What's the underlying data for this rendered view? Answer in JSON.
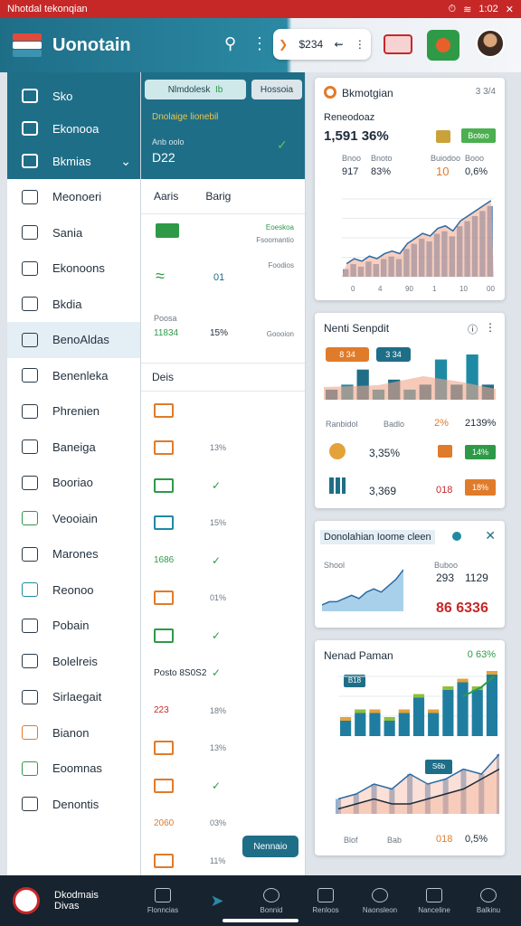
{
  "status": {
    "left": "Nhotdal tekonqian",
    "time": "1:02"
  },
  "app": {
    "title": "Uonotain",
    "pill_value": "$234"
  },
  "sidebar": {
    "top_items": [
      {
        "label": "Sko"
      },
      {
        "label": "Ekonooa"
      },
      {
        "label": "Bkmias"
      }
    ],
    "items": [
      {
        "label": "Meonoeri"
      },
      {
        "label": "Sania"
      },
      {
        "label": "Ekonoons"
      },
      {
        "label": "Bkdia"
      },
      {
        "label": "BenoAldas"
      },
      {
        "label": "Benenleka"
      },
      {
        "label": "Phrenien"
      },
      {
        "label": "Baneiga"
      },
      {
        "label": "Booriao"
      },
      {
        "label": "Veooiain"
      },
      {
        "label": "Marones"
      },
      {
        "label": "Reonoo"
      },
      {
        "label": "Pobain"
      },
      {
        "label": "Bolelreis"
      },
      {
        "label": "Sirlaegait"
      },
      {
        "label": "Bianon"
      },
      {
        "label": "Eoomnas"
      },
      {
        "label": "Denontis"
      }
    ]
  },
  "middle": {
    "tab1": "Nlmdolesk",
    "tab1b": "Ib",
    "tab2": "Hossoia",
    "small": "Dnolaige lionebil",
    "sub": "Anb oolo",
    "big": "D22",
    "col1": "Aaris",
    "col2": "Barig",
    "row1_label": "Eoeskoa",
    "row1_sub": "Fsoomantio",
    "row2_val": "01",
    "row2_label": "Foodios",
    "row3_title": "Poosa",
    "row3_val": "11834",
    "row3_pct": "15%",
    "row3_label": "Goooion",
    "details": "Deis",
    "details_rows": [
      {
        "kind": "icon",
        "color": "#e07b2a",
        "val": ""
      },
      {
        "kind": "icon",
        "color": "#e07b2a",
        "val": "13%"
      },
      {
        "kind": "icon",
        "color": "#2e9a48",
        "val": "✓"
      },
      {
        "kind": "icon",
        "color": "#1f8aa3",
        "val": "15%"
      },
      {
        "kind": "text",
        "text": "1686",
        "color": "#2e9a48",
        "val": "✓"
      },
      {
        "kind": "icon",
        "color": "#e07b2a",
        "val": "01%"
      },
      {
        "kind": "icon",
        "color": "#2e9a48",
        "val": "✓"
      },
      {
        "kind": "text",
        "text": "Posto 8S0S2",
        "color": "#1d2b3a",
        "val": "✓"
      },
      {
        "kind": "text",
        "text": "223",
        "color": "#c62828",
        "val": "18%"
      },
      {
        "kind": "icon",
        "color": "#e07b2a",
        "val": "13%"
      },
      {
        "kind": "icon",
        "color": "#e07b2a",
        "val": "✓"
      },
      {
        "kind": "text",
        "text": "2060",
        "color": "#e07b2a",
        "val": "03%"
      },
      {
        "kind": "icon",
        "color": "#e07b2a",
        "val": "11%"
      }
    ],
    "button": "Nennaio"
  },
  "card1": {
    "title": "Bkmotgian",
    "badge": "3 3/4",
    "subtitle": "Reneodoaz",
    "value": "1,591 36%",
    "green_tag": "Boteo",
    "stat1": "917",
    "stat2": "83%",
    "stat3": "10",
    "stat4": "0,6%",
    "stat_labels": [
      "Bnoo",
      "Bnoto",
      "Buiodoo",
      "Booo"
    ]
  },
  "card2": {
    "title": "Nenti Senpdit",
    "tag1": "8 34",
    "tag2": "3 34",
    "labels": [
      "Ranbidol",
      "Badlo",
      "2%",
      "2139%"
    ],
    "row1": "3,35%",
    "row2": "3,369",
    "row2_vals": [
      "018"
    ],
    "tag_green": "14%",
    "tag_orange": "18%"
  },
  "card3": {
    "title": "Donolahian Ioome cleen",
    "left_label": "Shool",
    "right_label": "Buboo",
    "v1": "293",
    "v2": "1129",
    "big": "86 6336"
  },
  "card4": {
    "title": "Nenad Paman",
    "badge": "0 63%",
    "tag": "B18",
    "tag2": "S6b",
    "foot": [
      "Blof",
      "Bab",
      "018",
      "0,5%"
    ]
  },
  "chart_data": [
    {
      "type": "bar",
      "title": "Bkmotgian",
      "categories": [
        "0",
        "4",
        "90",
        "1",
        "10",
        "00"
      ],
      "series": [
        {
          "values": [
            3,
            5,
            4,
            6,
            5,
            7,
            8,
            7,
            11,
            13,
            15,
            14,
            17,
            18,
            16,
            20,
            22,
            24,
            26,
            28
          ]
        }
      ],
      "ylim": [
        0,
        100
      ]
    },
    {
      "type": "bar",
      "title": "Nenti Senpdit",
      "series": [
        {
          "name": "",
          "values": [
            2,
            3,
            6,
            2,
            4,
            2,
            3,
            8,
            3,
            9,
            3
          ]
        }
      ]
    },
    {
      "type": "area",
      "title": "Donolahian Ioome cleen",
      "series": [
        {
          "values": [
            2,
            3,
            3,
            4,
            5,
            4,
            6,
            7,
            6,
            8,
            10,
            13
          ]
        }
      ]
    },
    {
      "type": "bar",
      "title": "Nenad Paman",
      "series": [
        {
          "name": "",
          "values": [
            2,
            3,
            3,
            2,
            3,
            5,
            3,
            6,
            7,
            6,
            8
          ]
        },
        {
          "name": "",
          "values": [
            1,
            2,
            2,
            1,
            2,
            3,
            2,
            5,
            6,
            5,
            8
          ]
        }
      ],
      "ylim": [
        0,
        100
      ]
    },
    {
      "type": "line",
      "series": [
        {
          "values": [
            3,
            4,
            6,
            5,
            8,
            6,
            7,
            9,
            8,
            12
          ]
        },
        {
          "values": [
            1,
            2,
            3,
            2,
            2,
            3,
            4,
            5,
            7,
            9
          ]
        }
      ]
    }
  ]
}
